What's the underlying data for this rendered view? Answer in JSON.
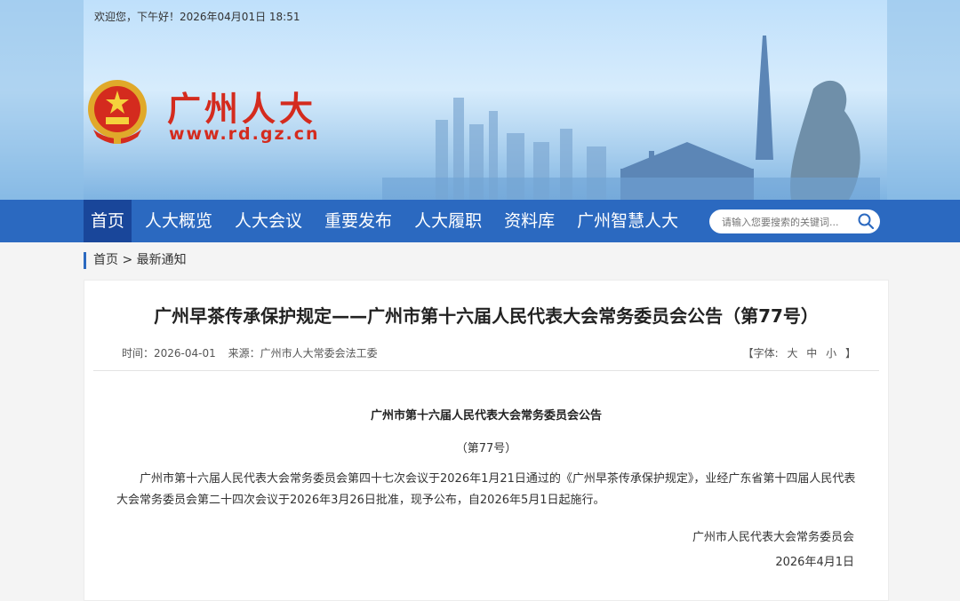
{
  "header": {
    "greeting": "欢迎您，下午好！2026年04月01日 18:51",
    "site_title": "广州人大",
    "site_url": "www.rd.gz.cn"
  },
  "nav": {
    "items": [
      {
        "label": "首页",
        "active": true
      },
      {
        "label": "人大概览"
      },
      {
        "label": "人大会议"
      },
      {
        "label": "重要发布"
      },
      {
        "label": "人大履职"
      },
      {
        "label": "资料库"
      },
      {
        "label": "广州智慧人大"
      }
    ],
    "search_placeholder": "请输入您要搜索的关键词..."
  },
  "breadcrumb": {
    "home": "首页",
    "sep": ">",
    "current": "最新通知"
  },
  "article": {
    "title": "广州早茶传承保护规定——广州市第十六届人民代表大会常务委员会公告（第77号）",
    "time": "时间：2026-04-01",
    "source": "来源：广州市人大常委会法工委",
    "fontsize_label": "【字体:",
    "fontsize_large": "大",
    "fontsize_medium": "中",
    "fontsize_small": "小",
    "fontsize_close": "】",
    "notice_heading": "广州市第十六届人民代表大会常务委员会公告",
    "notice_number": "（第77号）",
    "body": "广州市第十六届人民代表大会常务委员会第四十七次会议于2026年1月21日通过的《广州早茶传承保护规定》，业经广东省第十四届人民代表大会常务委员会第二十四次会议于2026年3月26日批准，现予公布，自2026年5月1日起施行。",
    "signature": "广州市人民代表大会常务委员会",
    "date": "2026年4月1日"
  },
  "colors": {
    "nav_bg": "#2b69c0",
    "nav_active": "#19469a",
    "brand_red": "#d42b1e"
  },
  "icons": [
    "national-emblem-icon",
    "search-icon"
  ]
}
